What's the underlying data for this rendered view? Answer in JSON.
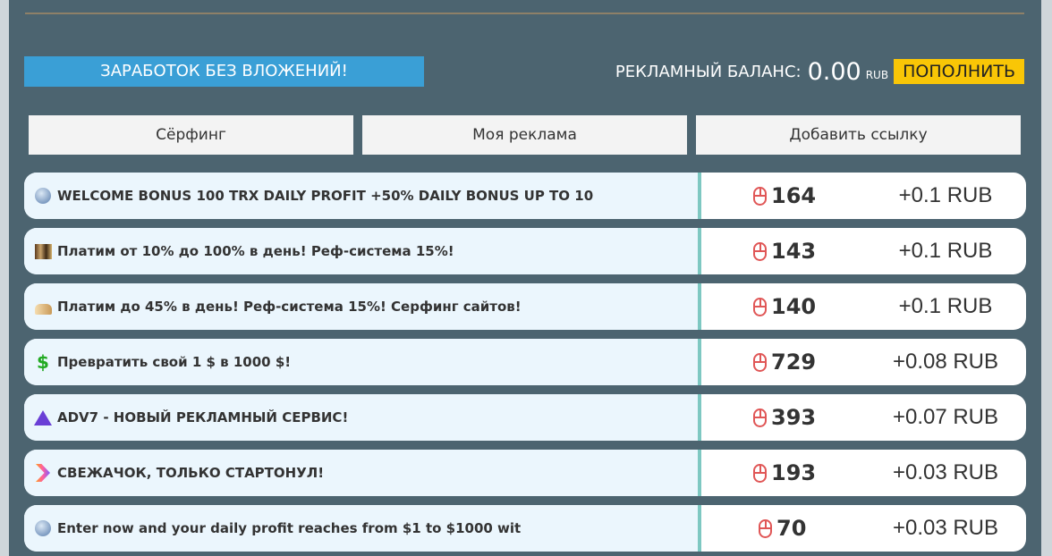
{
  "header": {
    "earn_banner": "ЗАРАБОТОК БЕЗ ВЛОЖЕНИЙ!",
    "balance_label": "РЕКЛАМНЫЙ БАЛАНС:",
    "balance_amount": "0.00",
    "balance_currency": "RUB",
    "topup_label": "ПОПОЛНИТЬ"
  },
  "tabs": [
    {
      "label": "Сёрфинг"
    },
    {
      "label": "Моя реклама"
    },
    {
      "label": "Добавить ссылку"
    }
  ],
  "ads": [
    {
      "icon": "globe-icon",
      "title": "WELCOME BONUS 100 TRX DAILY PROFIT +50% DAILY BONUS UP TO 10",
      "views": "164",
      "reward": "+0.1 RUB"
    },
    {
      "icon": "thumbnail-icon",
      "title": "Платим от 10% до 100% в день! Реф-система 15%!",
      "views": "143",
      "reward": "+0.1 RUB"
    },
    {
      "icon": "hand-icon",
      "title": "Платим до 45% в день! Реф-система 15%! Серфинг сайтов!",
      "views": "140",
      "reward": "+0.1 RUB"
    },
    {
      "icon": "dollar-icon",
      "title": "Превратить свой 1 $ в 1000 $!",
      "views": "729",
      "reward": "+0.08 RUB"
    },
    {
      "icon": "triangle-logo-icon",
      "title": "ADV7 - НОВЫЙ РЕКЛАМНЫЙ СЕРВИС!",
      "views": "393",
      "reward": "+0.07 RUB"
    },
    {
      "icon": "chevron-logo-icon",
      "title": "СВЕЖАЧОК, ТОЛЬКО СТАРТОНУЛ!",
      "views": "193",
      "reward": "+0.03 RUB"
    },
    {
      "icon": "globe-icon",
      "title": "Enter now and your daily profit reaches from $1 to $1000 wit",
      "views": "70",
      "reward": "+0.03 RUB"
    }
  ],
  "colors": {
    "panel": "#4c6470",
    "banner": "#3a9fd6",
    "topup": "#f9c606",
    "mouse_icon": "#e05656",
    "row_divider": "#7ec8c2"
  }
}
